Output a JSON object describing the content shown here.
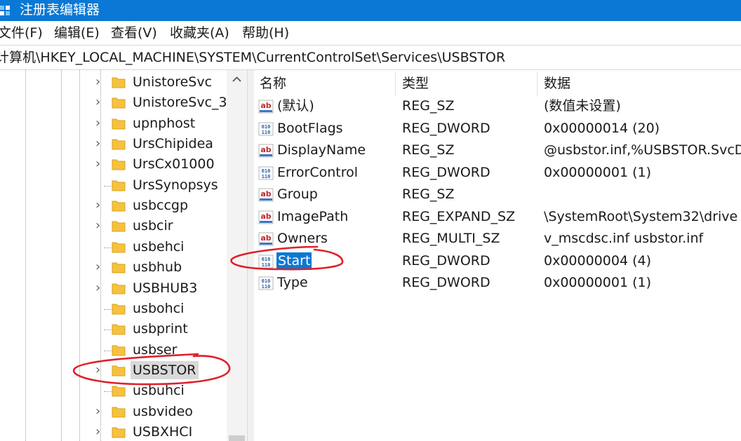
{
  "window": {
    "title": "注册表编辑器",
    "icon": "regedit-icon"
  },
  "menu": [
    "文件(F)",
    "编辑(E)",
    "查看(V)",
    "收藏夹(A)",
    "帮助(H)"
  ],
  "address": "计算机\\HKEY_LOCAL_MACHINE\\SYSTEM\\CurrentControlSet\\Services\\USBSTOR",
  "tree": {
    "items": [
      {
        "label": "UnistoreSvc",
        "expandable": true
      },
      {
        "label": "UnistoreSvc_3",
        "expandable": true
      },
      {
        "label": "upnphost",
        "expandable": true
      },
      {
        "label": "UrsChipidea",
        "expandable": true
      },
      {
        "label": "UrsCx01000",
        "expandable": true
      },
      {
        "label": "UrsSynopsys",
        "expandable": false
      },
      {
        "label": "usbccgp",
        "expandable": true
      },
      {
        "label": "usbcir",
        "expandable": true
      },
      {
        "label": "usbehci",
        "expandable": false
      },
      {
        "label": "usbhub",
        "expandable": true
      },
      {
        "label": "USBHUB3",
        "expandable": true
      },
      {
        "label": "usbohci",
        "expandable": false
      },
      {
        "label": "usbprint",
        "expandable": false
      },
      {
        "label": "usbser",
        "expandable": false
      },
      {
        "label": "USBSTOR",
        "expandable": true,
        "selected": true
      },
      {
        "label": "usbuhci",
        "expandable": false
      },
      {
        "label": "usbvideo",
        "expandable": true
      },
      {
        "label": "USBXHCI",
        "expandable": true
      }
    ],
    "expander_glyph": "›"
  },
  "list": {
    "columns": [
      "名称",
      "类型",
      "数据"
    ],
    "rows": [
      {
        "icon": "string-value-icon",
        "name": "(默认)",
        "type": "REG_SZ",
        "data": "(数值未设置)"
      },
      {
        "icon": "binary-value-icon",
        "name": "BootFlags",
        "type": "REG_DWORD",
        "data": "0x00000014 (20)"
      },
      {
        "icon": "string-value-icon",
        "name": "DisplayName",
        "type": "REG_SZ",
        "data": "@usbstor.inf,%USBSTOR.SvcD"
      },
      {
        "icon": "binary-value-icon",
        "name": "ErrorControl",
        "type": "REG_DWORD",
        "data": "0x00000001 (1)"
      },
      {
        "icon": "string-value-icon",
        "name": "Group",
        "type": "REG_SZ",
        "data": ""
      },
      {
        "icon": "string-value-icon",
        "name": "ImagePath",
        "type": "REG_EXPAND_SZ",
        "data": "\\SystemRoot\\System32\\drive"
      },
      {
        "icon": "string-value-icon",
        "name": "Owners",
        "type": "REG_MULTI_SZ",
        "data": "v_mscdsc.inf usbstor.inf"
      },
      {
        "icon": "binary-value-icon",
        "name": "Start",
        "type": "REG_DWORD",
        "data": "0x00000004 (4)",
        "selected": true
      },
      {
        "icon": "binary-value-icon",
        "name": "Type",
        "type": "REG_DWORD",
        "data": "0x00000001 (1)"
      }
    ]
  },
  "colors": {
    "titlebar": "#0a78d4",
    "selection": "#0a78d4",
    "tree_selection": "#d9d9d9",
    "annotation": "#e0202a",
    "folder": "#f6c23e"
  }
}
